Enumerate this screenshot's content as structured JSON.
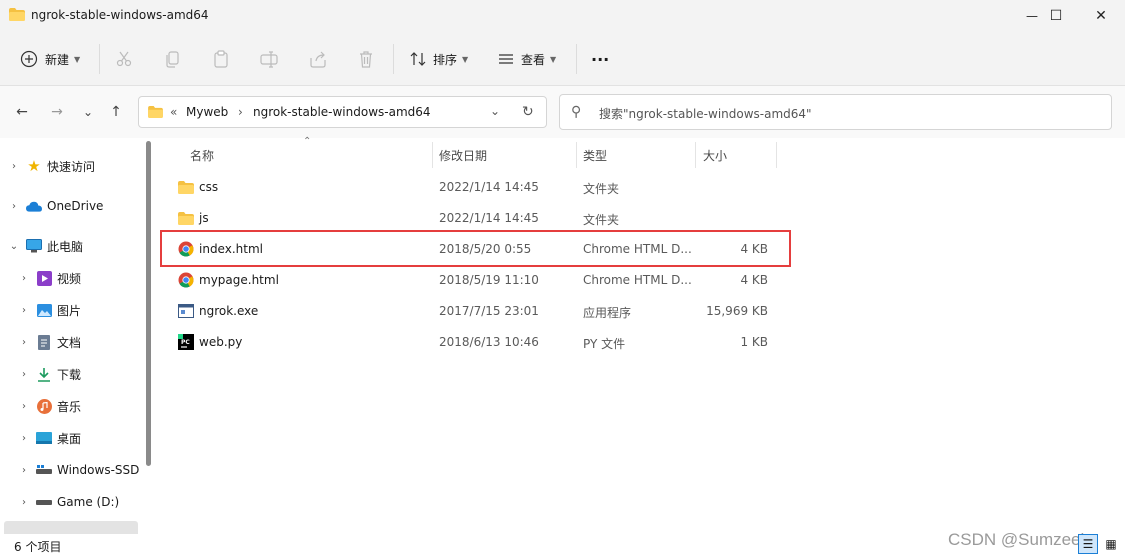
{
  "window": {
    "title": "ngrok-stable-windows-amd64",
    "minimize_glyph": "—",
    "maximize_glyph": "☐",
    "close_glyph": "✕"
  },
  "toolbar": {
    "new_label": "新建",
    "sort_label": "排序",
    "view_label": "查看",
    "more_label": "···",
    "icons": {
      "new": "plus-circle-icon",
      "cut": "scissors-icon",
      "copy": "copy-icon",
      "paste": "paste-icon",
      "rename": "rename-icon",
      "share": "share-icon",
      "delete": "trash-icon",
      "sort": "sort-icon",
      "view": "view-icon"
    }
  },
  "address_bar": {
    "back": "←",
    "forward": "→",
    "recent": "⌄",
    "up": "↑",
    "overflow": "«",
    "crumbs": [
      "Myweb",
      "ngrok-stable-windows-amd64"
    ],
    "separator": "›",
    "dropdown": "⌄",
    "refresh": "↻"
  },
  "search": {
    "placeholder": "搜索\"ngrok-stable-windows-amd64\""
  },
  "sidebar": {
    "items": [
      {
        "label": "快速访问",
        "icon": "star-icon",
        "expanded": false
      },
      {
        "label": "OneDrive",
        "icon": "cloud-icon",
        "expanded": false
      },
      {
        "label": "此电脑",
        "icon": "computer-icon",
        "expanded": true
      },
      {
        "label": "视频",
        "icon": "video-icon",
        "expanded": false
      },
      {
        "label": "图片",
        "icon": "image-icon",
        "expanded": false
      },
      {
        "label": "文档",
        "icon": "document-icon",
        "expanded": false
      },
      {
        "label": "下载",
        "icon": "download-icon",
        "expanded": false
      },
      {
        "label": "音乐",
        "icon": "music-icon",
        "expanded": false
      },
      {
        "label": "桌面",
        "icon": "desktop-icon",
        "expanded": false
      },
      {
        "label": "Windows-SSD",
        "icon": "drive-icon",
        "expanded": false
      },
      {
        "label": "Game (D:)",
        "icon": "drive-icon",
        "expanded": false
      }
    ]
  },
  "file_list": {
    "columns": {
      "name": "名称",
      "modified": "修改日期",
      "type": "类型",
      "size": "大小"
    },
    "sort_indicator": "⌃",
    "rows": [
      {
        "name": "css",
        "modified": "2022/1/14 14:45",
        "type": "文件夹",
        "size": "",
        "icon": "folder-icon"
      },
      {
        "name": "js",
        "modified": "2022/1/14 14:45",
        "type": "文件夹",
        "size": "",
        "icon": "folder-icon"
      },
      {
        "name": "index.html",
        "modified": "2018/5/20 0:55",
        "type": "Chrome HTML D...",
        "size": "4 KB",
        "icon": "chrome-icon"
      },
      {
        "name": "mypage.html",
        "modified": "2018/5/19 11:10",
        "type": "Chrome HTML D...",
        "size": "4 KB",
        "icon": "chrome-icon"
      },
      {
        "name": "ngrok.exe",
        "modified": "2017/7/15 23:01",
        "type": "应用程序",
        "size": "15,969 KB",
        "icon": "exe-icon"
      },
      {
        "name": "web.py",
        "modified": "2018/6/13 10:46",
        "type": "PY 文件",
        "size": "1 KB",
        "icon": "pycharm-icon"
      }
    ]
  },
  "status_bar": {
    "item_count": "6 个项目"
  },
  "watermark": "CSDN @Sumzeek",
  "colors": {
    "highlight": "#e53e3e",
    "folder": "#f5c142",
    "accent": "#0067c0"
  }
}
